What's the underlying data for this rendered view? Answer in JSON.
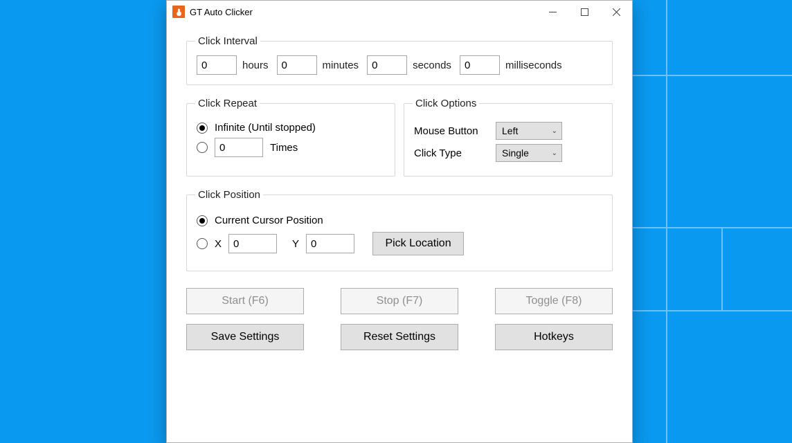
{
  "window": {
    "title": "GT Auto Clicker"
  },
  "interval": {
    "legend": "Click Interval",
    "hours": "0",
    "hours_label": "hours",
    "minutes": "0",
    "minutes_label": "minutes",
    "seconds": "0",
    "seconds_label": "seconds",
    "ms": "0",
    "ms_label": "milliseconds"
  },
  "repeat": {
    "legend": "Click Repeat",
    "infinite_label": "Infinite (Until stopped)",
    "times_value": "0",
    "times_label": "Times"
  },
  "options": {
    "legend": "Click Options",
    "mouse_button_label": "Mouse Button",
    "mouse_button_value": "Left",
    "click_type_label": "Click Type",
    "click_type_value": "Single"
  },
  "position": {
    "legend": "Click Position",
    "current_label": "Current Cursor Position",
    "x_label": "X",
    "x_value": "0",
    "y_label": "Y",
    "y_value": "0",
    "pick_label": "Pick Location"
  },
  "buttons": {
    "start": "Start (F6)",
    "stop": "Stop (F7)",
    "toggle": "Toggle (F8)",
    "save": "Save Settings",
    "reset": "Reset Settings",
    "hotkeys": "Hotkeys"
  }
}
